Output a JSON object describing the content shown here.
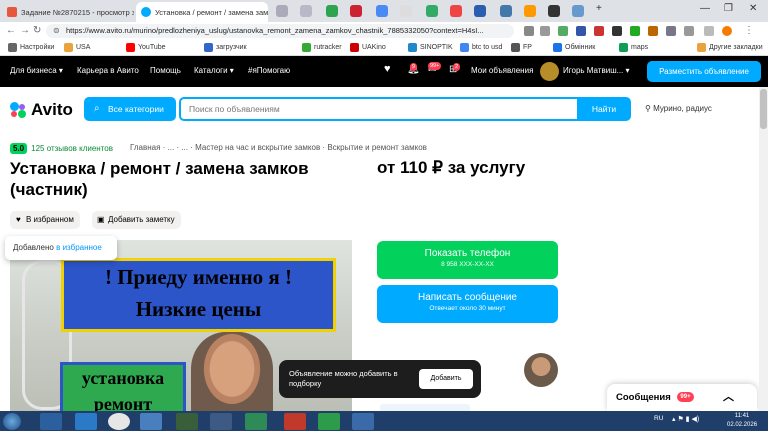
{
  "browser": {
    "tabs": [
      {
        "label": "Задание №2870215 - просмотр з",
        "favicon_color": "#e8573c"
      },
      {
        "label": "Установка / ремонт / замена зам",
        "favicon_color": "#00aaff"
      }
    ],
    "url": "https://www.avito.ru/murino/predlozheniya_uslug/ustanovka_remont_zamena_zamkov_chastnik_7885332050?context=H4sI...",
    "bookmarks": [
      "Настройки",
      "USA",
      "YouTube",
      "загрузчик",
      "rutracker",
      "UAKino",
      "SINOPTIK",
      "btc to usd",
      "FP",
      "Обмінник",
      "maps",
      "Другие закладки"
    ]
  },
  "avito_topbar": {
    "nav": [
      "Для бизнеса",
      "Карьера в Авито",
      "Помощь",
      "Каталоги",
      "#яПомогаю"
    ],
    "badges": [
      "9",
      "99+",
      "2"
    ],
    "my_ads": "Мои объявления",
    "user_name": "Игорь Матвиш...",
    "place_ad": "Разместить объявление"
  },
  "search": {
    "logo": "Avito",
    "categories_button": "Все категории",
    "placeholder": "Поиск по объявлениям",
    "find_button": "Найти",
    "location": "Мурино, радиус"
  },
  "listing": {
    "rating": "5.0",
    "reviews": "125 отзывов клиентов",
    "breadcrumbs": "Главная · ... · ... · Мастер на час и вскрытие замков · Вскрытие и ремонт замков",
    "title": "Установка / ремонт / замена замков (частник)",
    "price": "от 110 ₽ за услугу",
    "favorite_button": "В избранном",
    "note_button": "Добавить заметку",
    "fav_toast_text": "Добавлено",
    "fav_toast_link": "в избранное",
    "photo_sign_line1": "! Приеду именно я !",
    "photo_sign_line2": "Низкие цены",
    "photo_sign_bottom1": "установка",
    "photo_sign_bottom2": "ремонт"
  },
  "contact": {
    "phone_button": "Показать телефон",
    "phone_masked": "8 958 XXX-XX-XX",
    "message_button": "Написать сообщение",
    "message_sub": "Отвечает около 30 минут"
  },
  "selection_toast": {
    "text": "Объявление можно добавить в подборку",
    "button": "Добавить"
  },
  "chat": {
    "label": "Сообщения",
    "badge": "99+"
  },
  "taskbar": {
    "lang": "RU",
    "time": "11:41",
    "date": "02.02.2026"
  },
  "colors": {
    "avito_blue": "#00aaff",
    "avito_green": "#02d15c",
    "topbar": "#000000",
    "badge_red": "#ff4053"
  }
}
